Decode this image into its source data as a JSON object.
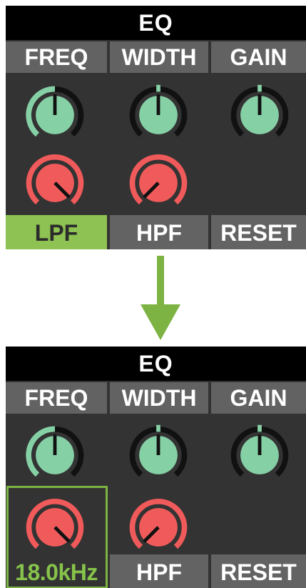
{
  "colors": {
    "panel_bg": "#333333",
    "header_bg": "#626262",
    "title_bg": "#000000",
    "knob_green": "#86d0a6",
    "knob_red": "#f05a5a",
    "active_green": "#8ec252",
    "selection_green": "#7cb342",
    "arrow_green": "#7cb342"
  },
  "before": {
    "title": "EQ",
    "headers": [
      "FREQ",
      "WIDTH",
      "GAIN"
    ],
    "buttons": {
      "lpf": "LPF",
      "hpf": "HPF",
      "reset": "RESET"
    },
    "active_button": "LPF"
  },
  "after": {
    "title": "EQ",
    "headers": [
      "FREQ",
      "WIDTH",
      "GAIN"
    ],
    "buttons": {
      "lpf_readout": "18.0kHz",
      "hpf": "HPF",
      "reset": "RESET"
    },
    "selected_control": "LPF"
  },
  "transition_icon": "down-arrow-icon"
}
